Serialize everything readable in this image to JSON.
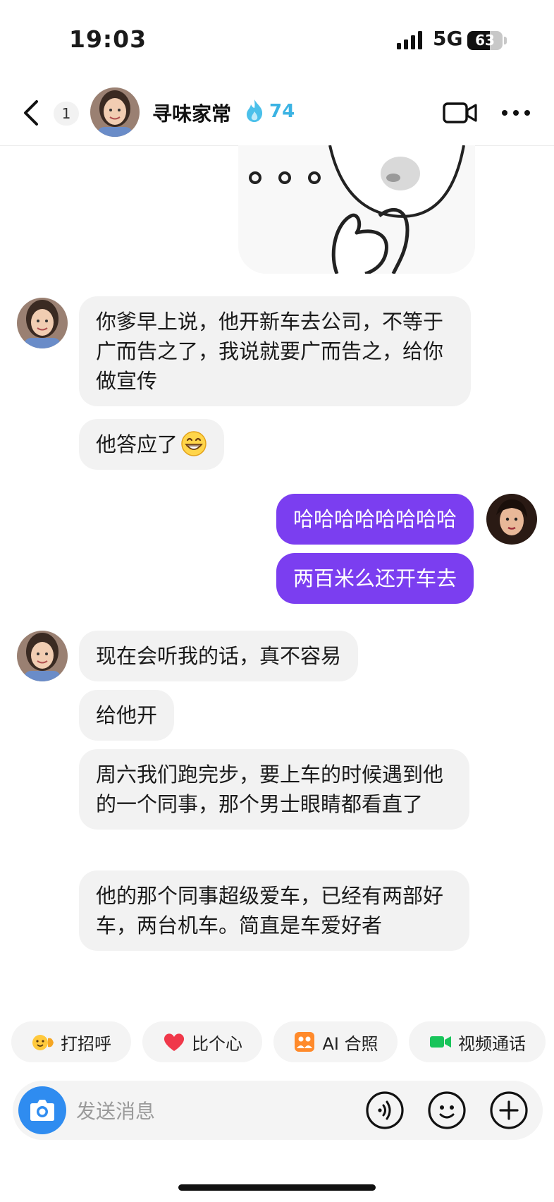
{
  "status": {
    "time": "19:03",
    "network": "5G",
    "battery": "63",
    "battery_level": 0.63
  },
  "header": {
    "unread_count": "1",
    "contact_name": "寻味家常",
    "streak": "74",
    "streak_color": "#3bb3e3"
  },
  "messages": [
    {
      "from": "contact",
      "text": "你爹早上说，他开新车去公司，不等于广而告之了，我说就要广而告之，给你做宣传"
    },
    {
      "from": "contact",
      "text": "他答应了",
      "emoji": "grinning-emoji"
    },
    {
      "from": "me",
      "text": "哈哈哈哈哈哈哈哈"
    },
    {
      "from": "me",
      "text": "两百米么还开车去"
    },
    {
      "from": "contact",
      "text": "现在会听我的话，真不容易"
    },
    {
      "from": "contact",
      "text": "给他开"
    },
    {
      "from": "contact",
      "text": "周六我们跑完步，要上车的时候遇到他的一个同事，那个男士眼睛都看直了"
    },
    {
      "from": "contact",
      "text": "他的那个同事超级爱车，已经有两部好车，两台机车。简直是车爱好者"
    }
  ],
  "quick_actions": [
    {
      "label": "打招呼",
      "icon": "wave-hand-icon"
    },
    {
      "label": "比个心",
      "icon": "heart-icon"
    },
    {
      "label": "AI 合照",
      "icon": "ai-photo-icon"
    },
    {
      "label": "视频通话",
      "icon": "video-call-icon"
    }
  ],
  "input": {
    "placeholder": "发送消息"
  },
  "colors": {
    "outgoing_bubble": "#7b3ef0",
    "incoming_bubble": "#f2f2f2",
    "camera_button": "#2f8cf0"
  }
}
